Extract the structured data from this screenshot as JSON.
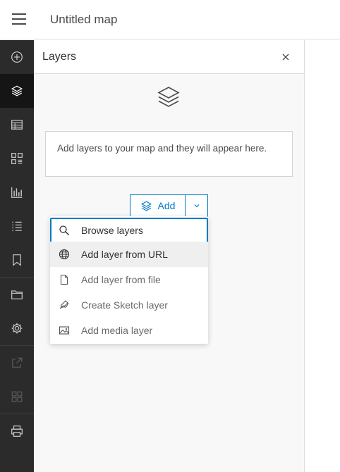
{
  "header": {
    "title": "Untitled map"
  },
  "rail": {
    "items": [
      {
        "icon": "add-circle-icon",
        "label": "Add"
      },
      {
        "icon": "layers-icon",
        "label": "Layers",
        "active": true
      },
      {
        "icon": "table-icon",
        "label": "Tables"
      },
      {
        "icon": "legend-icon",
        "label": "Legend"
      },
      {
        "icon": "charts-icon",
        "label": "Charts"
      },
      {
        "icon": "list-icon",
        "label": "Map properties"
      },
      {
        "icon": "bookmark-icon",
        "label": "Bookmarks"
      },
      {
        "icon": "folder-icon",
        "label": "Open"
      },
      {
        "icon": "gear-icon",
        "label": "Settings"
      },
      {
        "icon": "share-icon",
        "label": "Share",
        "disabled": true
      },
      {
        "icon": "apps-icon",
        "label": "Create app",
        "disabled": true
      },
      {
        "icon": "print-icon",
        "label": "Print"
      }
    ]
  },
  "panel": {
    "title": "Layers",
    "empty_message": "Add layers to your map and they will appear here.",
    "add_label": "Add"
  },
  "menu": {
    "items": [
      {
        "label": "Browse layers",
        "icon": "search-icon",
        "state": "focused"
      },
      {
        "label": "Add layer from URL",
        "icon": "globe-icon",
        "state": "hover"
      },
      {
        "label": "Add layer from file",
        "icon": "file-icon",
        "state": "normal"
      },
      {
        "label": "Create Sketch layer",
        "icon": "sketch-icon",
        "state": "normal"
      },
      {
        "label": "Add media layer",
        "icon": "image-icon",
        "state": "normal"
      }
    ]
  },
  "colors": {
    "accent": "#007ac2",
    "rail_bg": "#2b2b2b",
    "rail_active": "#151515"
  }
}
